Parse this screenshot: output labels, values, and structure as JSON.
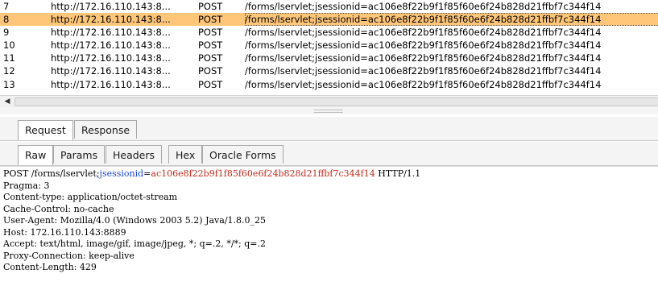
{
  "history": {
    "rows": [
      {
        "num": "7",
        "host": "http://172.16.110.143:8...",
        "method": "POST",
        "url": "/forms/lservlet;jsessionid=ac106e8f22b9f1f85f60e6f24b828d21ffbf7c344f14"
      },
      {
        "num": "8",
        "host": "http://172.16.110.143:8...",
        "method": "POST",
        "url": "/forms/lservlet;jsessionid=ac106e8f22b9f1f85f60e6f24b828d21ffbf7c344f14"
      },
      {
        "num": "9",
        "host": "http://172.16.110.143:8...",
        "method": "POST",
        "url": "/forms/lservlet;jsessionid=ac106e8f22b9f1f85f60e6f24b828d21ffbf7c344f14"
      },
      {
        "num": "10",
        "host": "http://172.16.110.143:8...",
        "method": "POST",
        "url": "/forms/lservlet;jsessionid=ac106e8f22b9f1f85f60e6f24b828d21ffbf7c344f14"
      },
      {
        "num": "11",
        "host": "http://172.16.110.143:8...",
        "method": "POST",
        "url": "/forms/lservlet;jsessionid=ac106e8f22b9f1f85f60e6f24b828d21ffbf7c344f14"
      },
      {
        "num": "12",
        "host": "http://172.16.110.143:8...",
        "method": "POST",
        "url": "/forms/lservlet;jsessionid=ac106e8f22b9f1f85f60e6f24b828d21ffbf7c344f14"
      },
      {
        "num": "13",
        "host": "http://172.16.110.143:8...",
        "method": "POST",
        "url": "/forms/lservlet;jsessionid=ac106e8f22b9f1f85f60e6f24b828d21ffbf7c344f14"
      }
    ],
    "selected_index": 1,
    "selected_color": "#ffc67a"
  },
  "scrollbar": {
    "left_arrow_icon": "left-arrow-icon",
    "arrow_glyph": "◀"
  },
  "tabs_outer": {
    "request": "Request",
    "response": "Response"
  },
  "tabs_inner": {
    "raw": "Raw",
    "params": "Params",
    "headers": "Headers",
    "hex": "Hex",
    "oracle_forms": "Oracle Forms"
  },
  "message": {
    "request_prefix": "POST /forms/lservlet;",
    "param_name": "jsessionid",
    "equals": "=",
    "param_value": "ac106e8f22b9f1f85f60e6f24b828d21ffbf7c344f14",
    "request_suffix": " HTTP/1.1",
    "headers": [
      "Pragma: 3",
      "Content-type: application/octet-stream",
      "Cache-Control: no-cache",
      "User-Agent: Mozilla/4.0 (Windows 2003 5.2) Java/1.8.0_25",
      "Host: 172.16.110.143:8889",
      "Accept: text/html, image/gif, image/jpeg, *; q=.2, */*; q=.2",
      "Proxy-Connection: keep-alive",
      "Content-Length: 429"
    ],
    "param_name_color": "#1b48d4",
    "param_value_color": "#c22a1b"
  }
}
